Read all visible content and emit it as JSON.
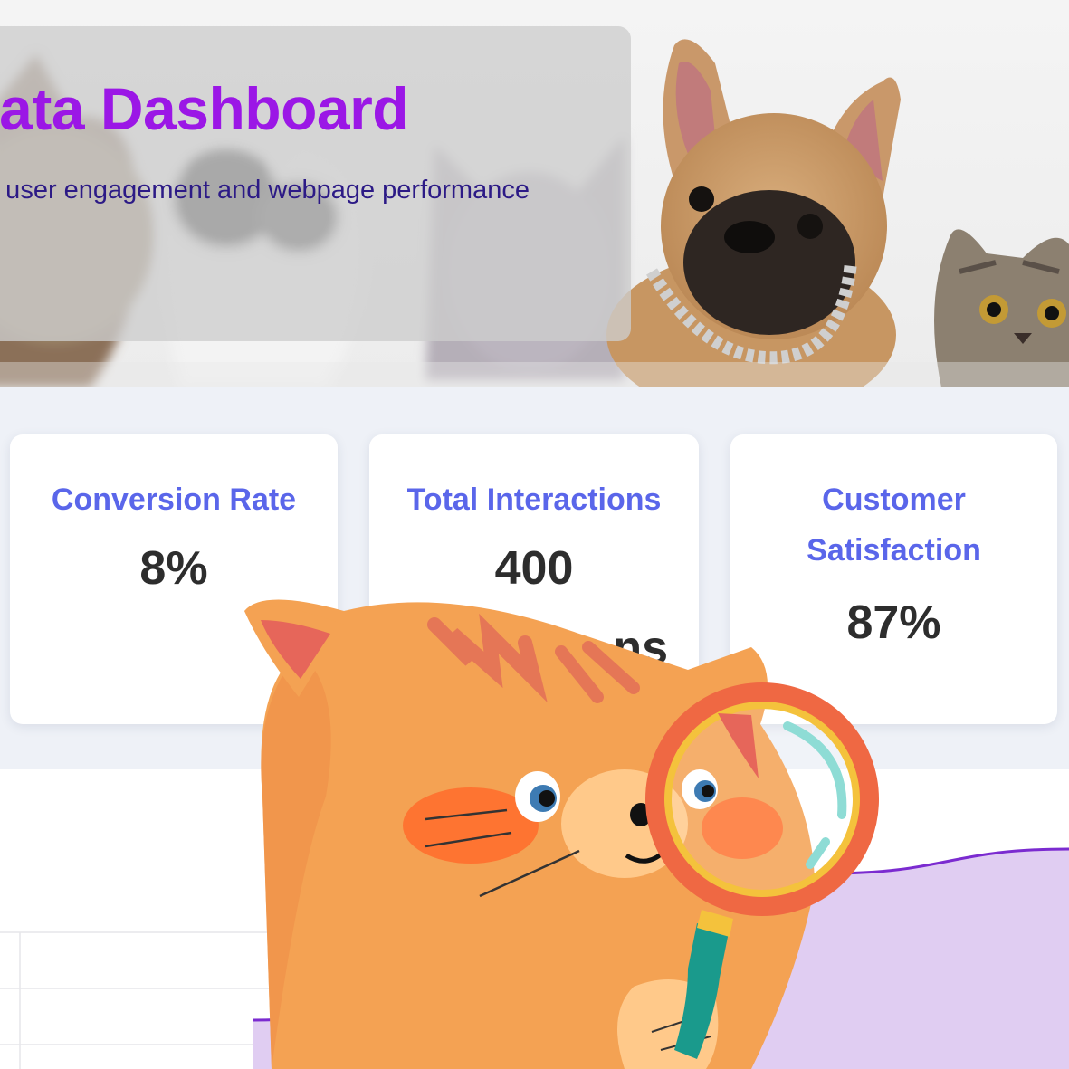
{
  "hero": {
    "title": "Data Dashboard",
    "subtitle": "o user engagement and webpage performance"
  },
  "metrics": [
    {
      "label": "Conversion Rate",
      "value": "8%"
    },
    {
      "label": "Total Interactions",
      "value": "400",
      "sub": "ns"
    },
    {
      "label": "Customer Satisfaction",
      "value": "87%"
    }
  ],
  "colors": {
    "title": "#9b17e6",
    "subtitle": "#2c1a86",
    "metric_label": "#5a66ea",
    "metric_value": "#2d2d2d",
    "series_line": "#7b2bd0",
    "series_fill": "#e0cdf2"
  },
  "chart_data": {
    "type": "area",
    "grid": true,
    "series": [
      {
        "values": [
          0.2,
          0.4,
          0.6,
          0.8,
          0.9
        ]
      }
    ]
  },
  "illustration": {
    "subject": "cartoon cat with magnifying glass",
    "photo_subject": "cats and dog"
  }
}
